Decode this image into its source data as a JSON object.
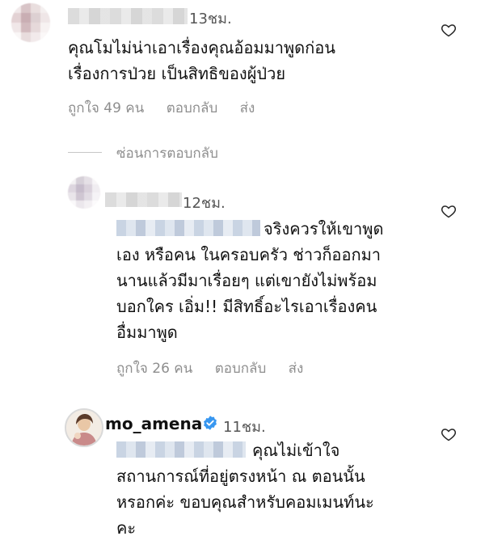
{
  "comments": [
    {
      "time": "13ชม.",
      "text_line1": "คุณโมไม่น่าเอาเรื่องคุณอ้อมมาพูดก่อน",
      "text_line2": "เรื่องการป่วย เป็นสิทธิของผู้ป่วย",
      "likes": "ถูกใจ 49 คน",
      "reply": "ตอบกลับ",
      "send": "ส่ง"
    }
  ],
  "hide_replies": "ซ่อนการตอบกลับ",
  "replies": [
    {
      "time": "12ชม.",
      "text_line1": "จริงควรให้เขาพูด",
      "text_line2": "เอง หรือคน ในครอบครัว ช่าวก็ออกมา",
      "text_line3": "นานแล้วมีมาเรื่อยๆ แต่เขายังไม่พร้อม",
      "text_line4": "บอกใคร เอิ่ม!! มีสิทธิ์อะไรเอาเรื่องคน",
      "text_line5": "อื่มมาพูด",
      "likes": "ถูกใจ 26 คน",
      "reply": "ตอบกลับ",
      "send": "ส่ง"
    },
    {
      "username": "mo_amena",
      "time": "11ชม.",
      "text_line1": "คุณไม่เข้าใจ",
      "text_line2": "สถานการณ์ที่อยู่ตรงหน้า ณ ตอนนั้น",
      "text_line3": "หรอกค่ะ ขอบคุณสำหรับคอมเมนท์นะ",
      "text_line4": "คะ"
    }
  ],
  "icons": {
    "heart": "heart-outline-icon",
    "verified": "verified-badge-icon"
  },
  "colors": {
    "verified": "#3897f0",
    "meta": "#8e8e8e"
  }
}
